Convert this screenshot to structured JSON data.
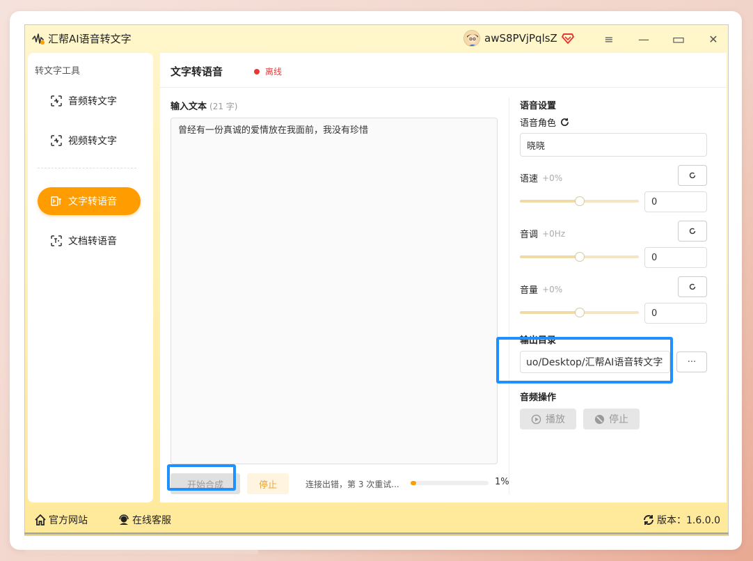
{
  "app": {
    "title": "汇帮AI语音转文字",
    "username": "awS8PVjPqlsZ"
  },
  "window_controls": {
    "menu": "≡",
    "minimize": "—",
    "maximize": "▭",
    "close": "✕"
  },
  "sidebar": {
    "title": "转文字工具",
    "items": [
      {
        "label": "音频转文字",
        "icon": "audio-to-text-icon",
        "active": false
      },
      {
        "label": "视频转文字",
        "icon": "video-to-text-icon",
        "active": false
      },
      {
        "label": "文字转语音",
        "icon": "text-to-speech-icon",
        "active": true
      },
      {
        "label": "文档转语音",
        "icon": "document-to-speech-icon",
        "active": false
      }
    ]
  },
  "main": {
    "title": "文字转语音",
    "status": "离线",
    "input_label": "输入文本",
    "char_count": "(21 字)",
    "text_value": "曾经有一份真诚的爱情放在我面前，我没有珍惜",
    "start_button": "开始合成",
    "stop_button": "停止",
    "progress_text": "连接出错，第 3 次重试...",
    "progress_value": 0.01,
    "progress_pct": "1%"
  },
  "settings": {
    "title": "语音设置",
    "voice_label": "语音角色",
    "voice_value": "晓晓",
    "speed": {
      "label": "语速",
      "hint": "+0%",
      "value": "0",
      "slider": 0.5
    },
    "pitch": {
      "label": "音调",
      "hint": "+0Hz",
      "value": "0",
      "slider": 0.5
    },
    "volume": {
      "label": "音量",
      "hint": "+0%",
      "value": "0",
      "slider": 0.5
    },
    "output_label": "输出目录",
    "output_value": "uo/Desktop/汇帮AI语音转文字",
    "browse_label": "···",
    "audio_ops_title": "音频操作",
    "play_label": "播放",
    "stop_label": "停止"
  },
  "footer": {
    "website": "官方网站",
    "support": "在线客服",
    "version": "版本：1.6.0.0"
  },
  "colors": {
    "accent": "#ff9d00",
    "offline": "#e53935",
    "highlight": "#1e90ff"
  }
}
